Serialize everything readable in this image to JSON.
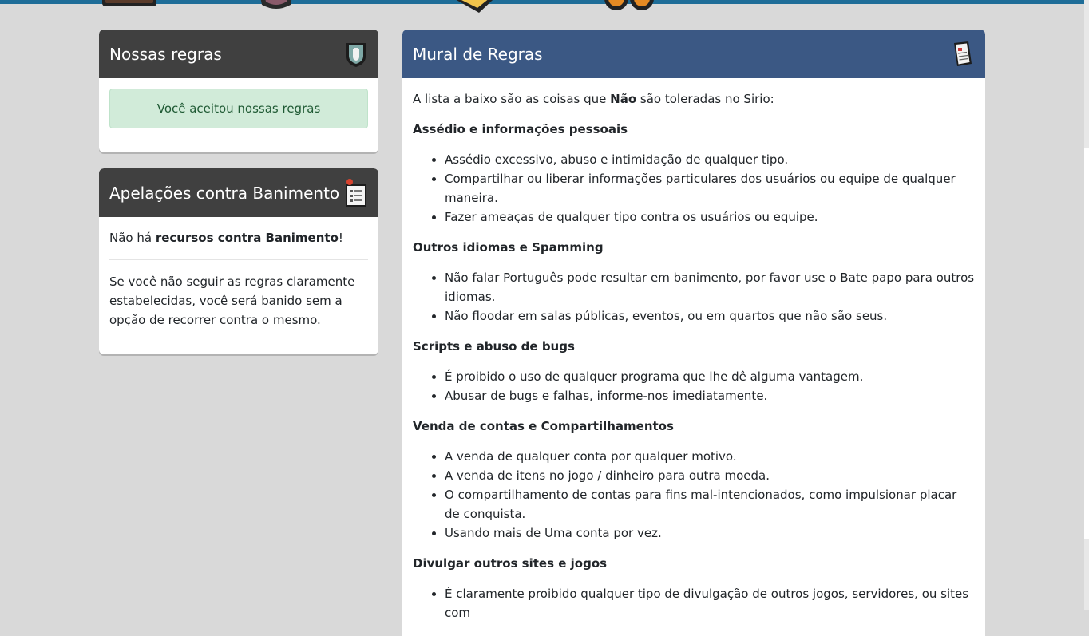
{
  "rules_panel": {
    "title": "Nossas regras",
    "accepted_text": "Você aceitou nossas regras"
  },
  "appeal_panel": {
    "title": "Apelações contra Banimento",
    "no_appeal_prefix": "Não há ",
    "no_appeal_bold": "recursos contra Banimento",
    "no_appeal_suffix": "!",
    "description": "Se você não seguir as regras claramente estabelecidas, você será banido sem a opção de recorrer contra o mesmo."
  },
  "board_panel": {
    "title": "Mural de Regras",
    "intro_prefix": "A lista a baixo são as coisas que ",
    "intro_bold": "Não",
    "intro_suffix": " são toleradas no Sirio:",
    "sections": [
      {
        "heading": "Assédio e informações pessoais",
        "items": [
          "Assédio excessivo, abuso e intimidação de qualquer tipo.",
          "Compartilhar ou liberar informações particulares dos usuários ou equipe de qualquer maneira.",
          "Fazer ameaças de qualquer tipo contra os usuários ou equipe."
        ]
      },
      {
        "heading": "Outros idiomas e Spamming",
        "items": [
          "Não falar Português pode resultar em banimento, por favor use o Bate papo para outros idiomas.",
          "Não floodar em salas públicas, eventos, ou em quartos que não são seus."
        ]
      },
      {
        "heading": "Scripts e abuso de bugs",
        "items": [
          "É proibido o uso de qualquer programa que lhe dê alguma vantagem.",
          "Abusar de bugs e falhas, informe-nos imediatamente."
        ]
      },
      {
        "heading": "Venda de contas e Compartilhamentos",
        "items": [
          "A venda de qualquer conta por qualquer motivo.",
          "A venda de itens no jogo / dinheiro para outra moeda.",
          "O compartilhamento de contas para fins mal-intencionados, como impulsionar placar de conquista.",
          "Usando mais de Uma conta por vez."
        ]
      },
      {
        "heading": "Divulgar outros sites e jogos",
        "items": [
          "É claramente proibido qualquer tipo de divulgação de outros jogos, servidores, ou sites com"
        ]
      }
    ]
  },
  "icons": {
    "rules_header_icon": "shield-icon",
    "appeal_header_icon": "clipboard-icon",
    "board_header_icon": "newspaper-icon"
  },
  "colors": {
    "page_bg": "#d9d9d9",
    "top_bar": "#1e6d98",
    "dark_header": "#404040",
    "blue_header": "#3b5884",
    "success_bg": "#d1ebd9",
    "success_text": "#1f5a34"
  }
}
